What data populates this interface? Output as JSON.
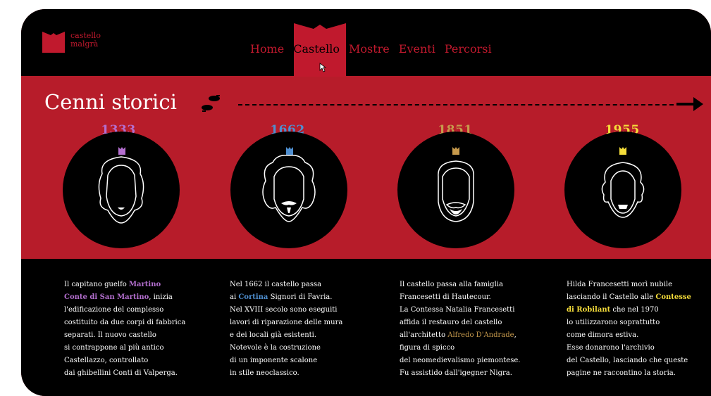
{
  "brand": {
    "line1": "castello",
    "line2": "malgrà",
    "color": "#c0192d"
  },
  "nav": [
    "Home",
    "Castello",
    "Mostre",
    "Eventi",
    "Percorsi"
  ],
  "active_nav": "Castello",
  "section": {
    "title": "Cenni storici"
  },
  "eras": [
    {
      "year": "1333",
      "color": "#b46fcf"
    },
    {
      "year": "1662",
      "color": "#4f8fd0"
    },
    {
      "year": "1851",
      "color": "#c79a4c"
    },
    {
      "year": "1955",
      "color": "#f5dd3a"
    }
  ],
  "descriptions": [
    {
      "lines": [
        [
          "Il capitano guelfo ",
          {
            "hl": "Martino"
          }
        ],
        [
          {
            "hl": "Conte di San Martino"
          },
          ", inizia"
        ],
        [
          "l'edificazione del complesso"
        ],
        [
          "costituito da due corpi di fabbrica"
        ],
        [
          "separati.  Il nuovo castello"
        ],
        [
          "si contrappone al più antico"
        ],
        [
          "Castellazzo, controllato"
        ],
        [
          "dai ghibellini Conti di Valperga."
        ]
      ],
      "hl_class": "hl-purple"
    },
    {
      "lines": [
        [
          "Nel 1662 il castello passa"
        ],
        [
          "ai ",
          {
            "hl": "Cortina"
          },
          " Signori di Favria."
        ],
        [
          "Nel XVIII secolo sono eseguiti"
        ],
        [
          "lavori di riparazione delle mura"
        ],
        [
          "e dei locali già esistenti."
        ],
        [
          "Notevole è la costruzione"
        ],
        [
          "di un imponente scalone"
        ],
        [
          "in stile neoclassico."
        ]
      ],
      "hl_class": "hl-blue"
    },
    {
      "lines": [
        [
          " Il castello passa alla famiglia"
        ],
        [
          "Francesetti di Hautecour."
        ],
        [
          "La Contessa Natalia Francesetti"
        ],
        [
          "affida il restauro del castello"
        ],
        [
          "all'architetto ",
          {
            "hl": "Alfredo D'Andrade"
          },
          ","
        ],
        [
          "figura di spicco"
        ],
        [
          "del neomedievalismo piemontese."
        ],
        [
          "Fu assistido dall'igegner Nigra."
        ]
      ],
      "hl_class": "hl-gold"
    },
    {
      "lines": [
        [
          "Hilda Francesetti morì nubile"
        ],
        [
          "lasciando il Castello alle ",
          {
            "hl": "Contesse"
          }
        ],
        [
          {
            "hl": "di Robilant"
          },
          " che nel 1970"
        ],
        [
          "lo utilizzarono soprattutto"
        ],
        [
          "come dimora estiva."
        ],
        [
          "Esse donarono l'archivio"
        ],
        [
          "del Castello, lasciando che queste"
        ],
        [
          "pagine ne raccontino la storia."
        ]
      ],
      "hl_class": "hl-yellow"
    }
  ]
}
